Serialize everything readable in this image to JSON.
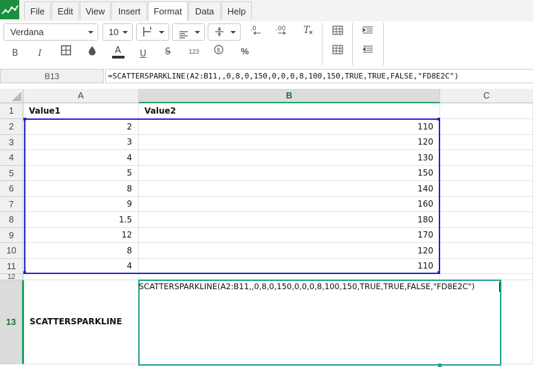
{
  "menu": [
    "File",
    "Edit",
    "View",
    "Insert",
    "Format",
    "Data",
    "Help"
  ],
  "toolbar": {
    "font_name": "Verdana",
    "font_size": "10"
  },
  "formula_bar": {
    "name_box": "B13",
    "formula": "=SCATTERSPARKLINE(A2:B11,,0,8,0,150,0,0,0,8,100,150,TRUE,TRUE,FALSE,\"FD8E2C\")"
  },
  "columns": [
    "A",
    "B",
    "C"
  ],
  "headers": {
    "a1": "Value1",
    "b1": "Value2"
  },
  "rows": [
    {
      "n": "2",
      "a": "2",
      "b": "110"
    },
    {
      "n": "3",
      "a": "3",
      "b": "120"
    },
    {
      "n": "4",
      "a": "4",
      "b": "130"
    },
    {
      "n": "5",
      "a": "5",
      "b": "150"
    },
    {
      "n": "6",
      "a": "8",
      "b": "140"
    },
    {
      "n": "7",
      "a": "9",
      "b": "160"
    },
    {
      "n": "8",
      "a": "1.5",
      "b": "180"
    },
    {
      "n": "9",
      "a": "12",
      "b": "170"
    },
    {
      "n": "10",
      "a": "8",
      "b": "120"
    },
    {
      "n": "11",
      "a": "4",
      "b": "110"
    }
  ],
  "row_labels": {
    "r1": "1",
    "r12": "12",
    "r13": "13"
  },
  "a13": "SCATTERSPARKLINE",
  "b13_edit": "SCATTERSPARKLINE(A2:B11,,0,8,0,150,0,0,0,8,100,150,TRUE,TRUE,FALSE,\"FD8E2C\")",
  "colors": {
    "accent": "#21a366",
    "selection": "#2222cc",
    "edit_border": "#1fa08a"
  }
}
